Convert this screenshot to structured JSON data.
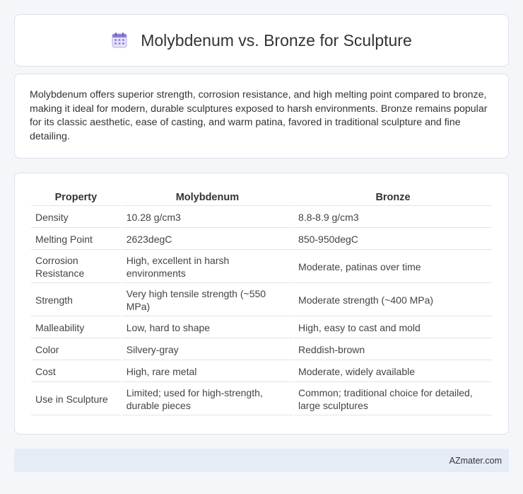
{
  "title": "Molybdenum vs. Bronze for Sculpture",
  "summary": "Molybdenum offers superior strength, corrosion resistance, and high melting point compared to bronze, making it ideal for modern, durable sculptures exposed to harsh environments. Bronze remains popular for its classic aesthetic, ease of casting, and warm patina, favored in traditional sculpture and fine detailing.",
  "table": {
    "headers": [
      "Property",
      "Molybdenum",
      "Bronze"
    ],
    "rows": [
      [
        "Density",
        "10.28 g/cm3",
        "8.8-8.9 g/cm3"
      ],
      [
        "Melting Point",
        "2623degC",
        "850-950degC"
      ],
      [
        "Corrosion Resistance",
        "High, excellent in harsh environments",
        "Moderate, patinas over time"
      ],
      [
        "Strength",
        "Very high tensile strength (~550 MPa)",
        "Moderate strength (~400 MPa)"
      ],
      [
        "Malleability",
        "Low, hard to shape",
        "High, easy to cast and mold"
      ],
      [
        "Color",
        "Silvery-gray",
        "Reddish-brown"
      ],
      [
        "Cost",
        "High, rare metal",
        "Moderate, widely available"
      ],
      [
        "Use in Sculpture",
        "Limited; used for high-strength, durable pieces",
        "Common; traditional choice for detailed, large sculptures"
      ]
    ]
  },
  "footer": "AZmater.com",
  "icon": "calendar-icon"
}
